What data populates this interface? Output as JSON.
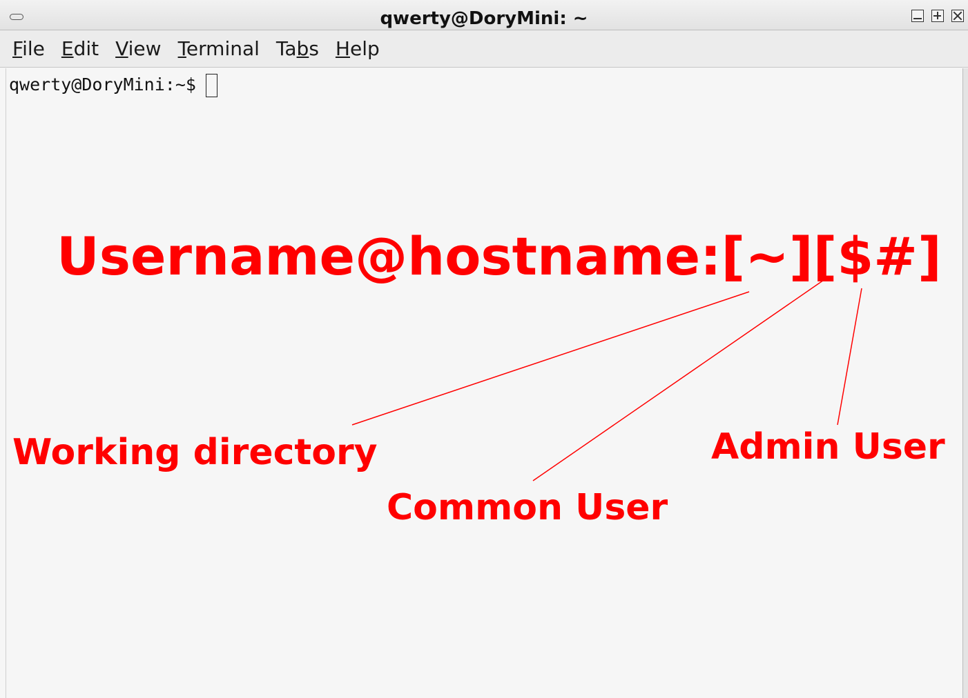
{
  "window": {
    "title": "qwerty@DoryMini: ~"
  },
  "menubar": {
    "items": [
      {
        "mnemonic": "F",
        "rest": "ile"
      },
      {
        "mnemonic": "E",
        "rest": "dit"
      },
      {
        "mnemonic": "V",
        "rest": "iew"
      },
      {
        "mnemonic": "T",
        "rest": "erminal"
      },
      {
        "pre": "Ta",
        "mnemonic": "b",
        "rest": "s"
      },
      {
        "mnemonic": "H",
        "rest": "elp"
      }
    ]
  },
  "terminal": {
    "prompt": "qwerty@DoryMini:~$"
  },
  "annotation": {
    "title": "Username@hostname:[~][$#]",
    "working_directory": "Working directory",
    "common_user": "Common User",
    "admin_user": "Admin User",
    "color": "#ff0000"
  }
}
